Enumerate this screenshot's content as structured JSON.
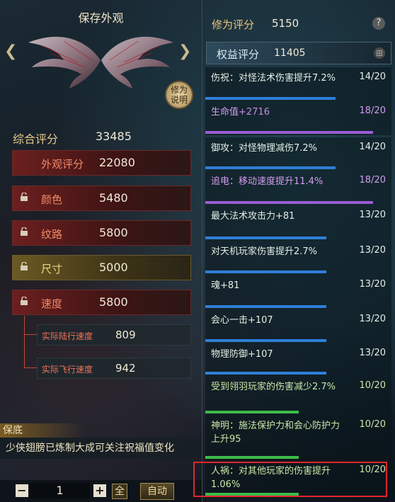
{
  "left": {
    "title": "保存外观",
    "explain_label": "修为说明",
    "summary": {
      "label": "综合评分",
      "value": "33485"
    },
    "appearance": {
      "label": "外观评分",
      "value": "22080"
    },
    "items": [
      {
        "label": "颜色",
        "value": "5480"
      },
      {
        "label": "纹路",
        "value": "5800"
      },
      {
        "label": "尺寸",
        "value": "5000"
      },
      {
        "label": "速度",
        "value": "5800"
      }
    ],
    "subs": [
      {
        "label": "实际陆行速度",
        "value": "809"
      },
      {
        "label": "实际飞行速度",
        "value": "942"
      }
    ],
    "notice_tag": "保底",
    "notice": "少侠翅膀已炼制大成可关注祝福值变化",
    "bottom": {
      "minus": "−",
      "quantity": "1",
      "plus": "+",
      "all": "全",
      "auto": "自动"
    }
  },
  "right": {
    "cultivation": {
      "label": "修为评分",
      "value": "5150",
      "help": "?"
    },
    "benefit": {
      "label": "权益评分",
      "value": "11405"
    },
    "attributes": [
      {
        "name": "伤祝：对怪法术伤害提升7.2%",
        "ratio": "14/20",
        "progress": 0.7,
        "color": "#2e7fd8",
        "style": ""
      },
      {
        "name_main": "生命值",
        "name_plus": "+2716",
        "ratio": "18/20",
        "progress": 0.9,
        "color": "#9b5bd3",
        "style": "purple"
      },
      {
        "name": "御攻：对怪物理减伤7.2%",
        "ratio": "14/20",
        "progress": 0.7,
        "color": "#2e7fd8",
        "style": ""
      },
      {
        "name": "追电：移动速度提升11.4%",
        "ratio": "18/20",
        "progress": 0.9,
        "color": "#9b5bd3",
        "style": "purple"
      },
      {
        "name": "最大法术攻击力+81",
        "ratio": "13/20",
        "progress": 0.65,
        "color": "#2e7fd8",
        "style": ""
      },
      {
        "name": "对天机玩家伤害提升2.7%",
        "ratio": "13/20",
        "progress": 0.65,
        "color": "#2e7fd8",
        "style": ""
      },
      {
        "name": "魂+81",
        "ratio": "13/20",
        "progress": 0.65,
        "color": "#2e7fd8",
        "style": ""
      },
      {
        "name": "会心一击+107",
        "ratio": "13/20",
        "progress": 0.65,
        "color": "#2e7fd8",
        "style": ""
      },
      {
        "name": "物理防御+107",
        "ratio": "13/20",
        "progress": 0.65,
        "color": "#2e7fd8",
        "style": ""
      },
      {
        "name": "受到翎羽玩家的伤害减少2.7%",
        "ratio": "10/20",
        "progress": 0.5,
        "color": "#3dbb4a",
        "style": "green"
      },
      {
        "name": "神明：施法保护力和会心防护力上升95",
        "ratio": "10/20",
        "progress": 0.5,
        "color": "#3dbb4a",
        "style": "green"
      },
      {
        "name": "人祸：对其他玩家的伤害提升1.06%",
        "ratio": "10/20",
        "progress": 0.5,
        "color": "#3dbb4a",
        "style": "green"
      }
    ]
  },
  "colors": {
    "highlight": "#e2262c"
  }
}
